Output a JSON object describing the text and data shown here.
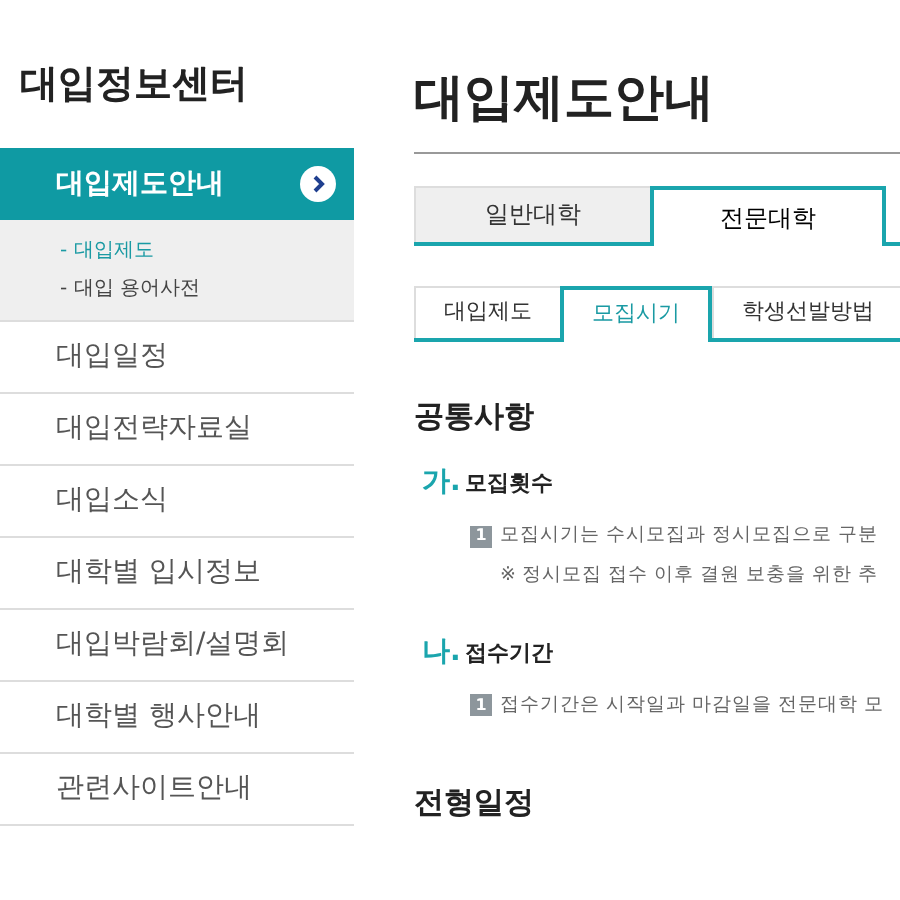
{
  "sidebar": {
    "title": "대입정보센터",
    "items": [
      {
        "label": "대입제도안내",
        "selected": true,
        "children": [
          {
            "label": "- 대입제도",
            "selected": true
          },
          {
            "label": "- 대입 용어사전",
            "selected": false
          }
        ]
      },
      {
        "label": "대입일정",
        "selected": false
      },
      {
        "label": "대입전략자료실",
        "selected": false
      },
      {
        "label": "대입소식",
        "selected": false
      },
      {
        "label": "대학별 입시정보",
        "selected": false
      },
      {
        "label": "대입박람회/설명회",
        "selected": false
      },
      {
        "label": "대학별 행사안내",
        "selected": false
      },
      {
        "label": "관련사이트안내",
        "selected": false
      }
    ]
  },
  "main": {
    "title": "대입제도안내",
    "tabs": [
      {
        "label": "일반대학",
        "selected": false
      },
      {
        "label": "전문대학",
        "selected": true
      }
    ],
    "subtabs": [
      {
        "label": "대입제도",
        "selected": false
      },
      {
        "label": "모집시기",
        "selected": true
      },
      {
        "label": "학생선발방법",
        "selected": false
      }
    ],
    "sections": [
      {
        "heading": "공통사항",
        "items": [
          {
            "marker": "가.",
            "title": "모집횟수",
            "lines": [
              {
                "kind": "numbered",
                "number": "1",
                "text": "모집시기는 수시모집과 정시모집으로 구분"
              },
              {
                "kind": "note",
                "text": "※ 정시모집 접수 이후 결원 보충을 위한 추"
              }
            ]
          },
          {
            "marker": "나.",
            "title": "접수기간",
            "lines": [
              {
                "kind": "numbered",
                "number": "1",
                "text": "접수기간은 시작일과 마감일을 전문대학 모"
              }
            ]
          }
        ]
      },
      {
        "heading": "전형일정"
      }
    ]
  }
}
